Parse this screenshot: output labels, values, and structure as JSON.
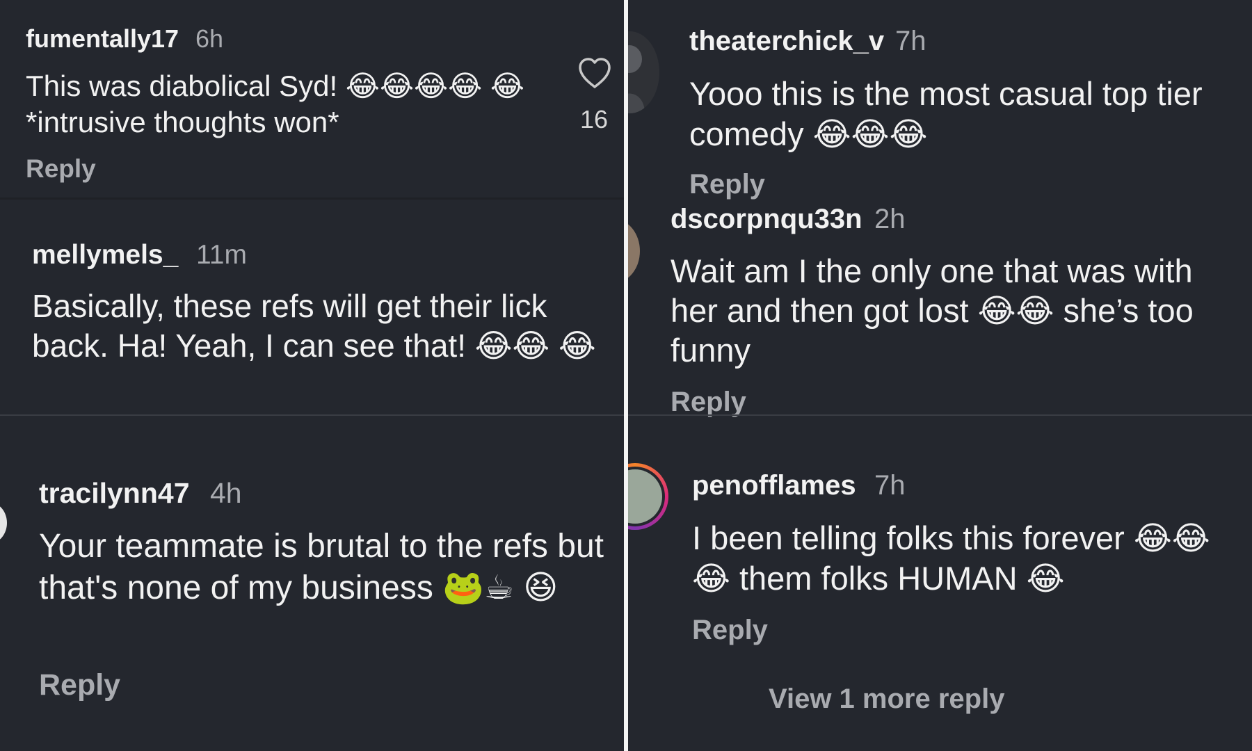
{
  "reply_label": "Reply",
  "left": {
    "comments": [
      {
        "username": "fumentally17",
        "time": "6h",
        "text": "This was diabolical Syd! 😂😂😂😂 😂 *intrusive thoughts won*",
        "likes": "16"
      },
      {
        "username": "mellymels_",
        "time": "11m",
        "text": "Basically, these refs will get their lick back. Ha! Yeah, I can see that! 😂😂 😂"
      },
      {
        "username": "tracilynn47",
        "time": "4h",
        "text": "Your teammate is brutal to the refs but that's none of my business 🐸☕ 😆"
      }
    ]
  },
  "right": {
    "comments": [
      {
        "username": "theaterchick_v",
        "time": "7h",
        "text": "Yooo this is the most casual top tier comedy 😂😂😂"
      },
      {
        "username": "dscorpnqu33n",
        "time": "2h",
        "text": "Wait am I the only one that was with her and then got lost 😂😂 she’s too funny"
      },
      {
        "username": "penofflames",
        "time": "7h",
        "text": "I been telling folks this forever 😂😂 😂 them folks HUMAN 😂"
      }
    ],
    "view_more": "View 1 more reply"
  },
  "icons": {
    "like": "heart-outline-icon"
  },
  "colors": {
    "background": "#24272e",
    "text": "#f2f2f2",
    "muted": "#a9abb0",
    "story_ring_a": "#c2187a",
    "story_ring_b": "#f58529"
  }
}
